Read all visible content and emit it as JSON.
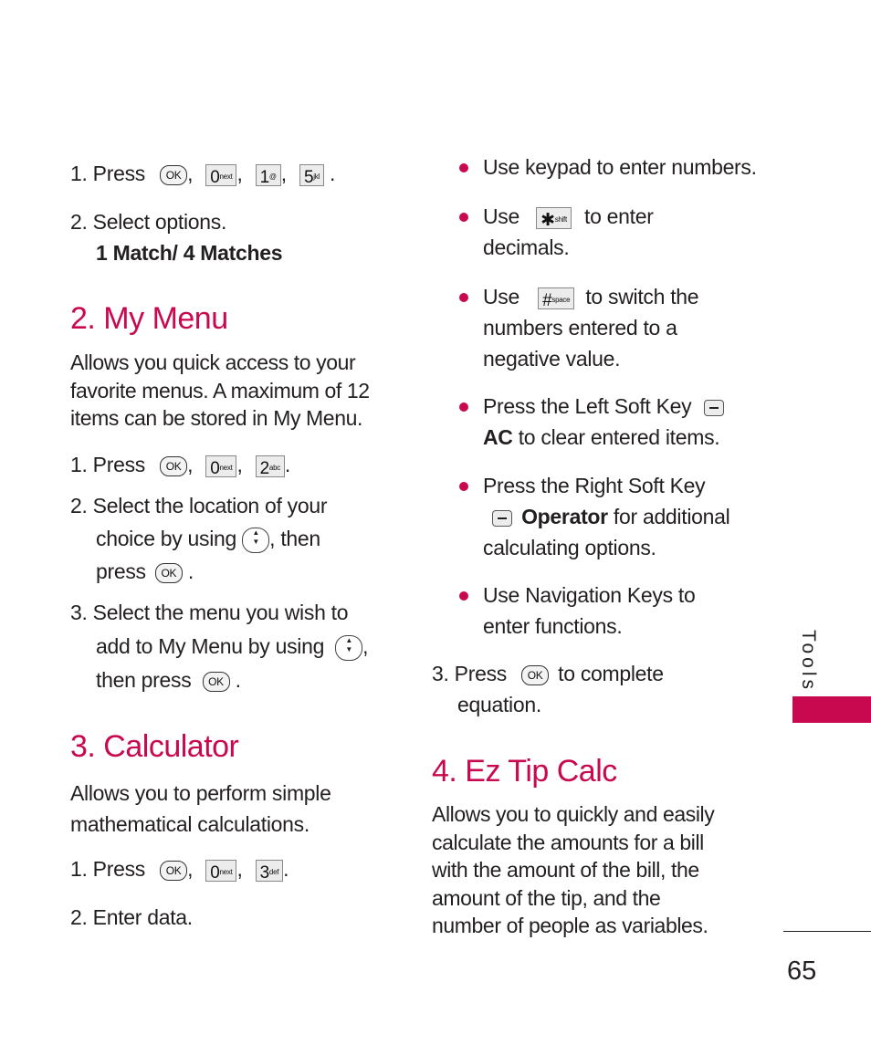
{
  "page": {
    "side_tab": "Tools",
    "page_number": "65",
    "accent_color": "#c8094f"
  },
  "left_column": {
    "intro_step1": {
      "prefix": "1. Press",
      "keys": [
        "OK",
        "0 next",
        "1 @",
        "5 jkl"
      ]
    },
    "intro_step2": {
      "text": "2. Select options.",
      "options": "1 Match/ 4 Matches"
    },
    "my_menu": {
      "heading": "2. My Menu",
      "description": [
        "Allows you quick access to your",
        "favorite menus. A maximum of 12",
        "items can be stored in My Menu."
      ],
      "step1": {
        "prefix": "1. Press",
        "keys": [
          "OK",
          "0 next",
          "2 abc"
        ]
      },
      "step2": {
        "line1": "2. Select the location of your",
        "line2_a": "choice by using",
        "line2_b": ", then",
        "line3": "press"
      },
      "step3": {
        "line1": "3. Select the menu you wish to",
        "line2": "add to My Menu by using",
        "line3": "then press"
      }
    },
    "calculator": {
      "heading": "3. Calculator",
      "description": [
        "Allows you to perform simple",
        "mathematical calculations."
      ],
      "step1": {
        "prefix": "1. Press",
        "keys": [
          "OK",
          "0 next",
          "3 def"
        ]
      },
      "step2": "2. Enter data."
    }
  },
  "right_column": {
    "bullets": [
      {
        "text": "Use keypad to enter numbers."
      },
      {
        "a": "Use",
        "key": "* shift",
        "b": "to enter",
        "c": "decimals."
      },
      {
        "a": "Use",
        "key": "# space",
        "b": "to switch the",
        "c": "numbers entered to a",
        "d": "negative value."
      },
      {
        "a": "Press the Left Soft Key",
        "bold": "AC",
        "b": "to clear entered items."
      },
      {
        "a": "Press the Right Soft Key",
        "bold": "Operator",
        "b": "for additional",
        "c": "calculating options."
      },
      {
        "a": "Use Navigation Keys to",
        "b": "enter functions."
      }
    ],
    "step3": {
      "a": "3. Press",
      "b": "to complete",
      "c": "equation."
    },
    "ez_tip": {
      "heading": "4. Ez Tip Calc",
      "description": [
        "Allows you to quickly and easily",
        "calculate the amounts for a bill",
        "with the amount of the bill, the",
        "amount of the tip, and the",
        "number of people as variables."
      ]
    }
  },
  "keys": {
    "ok": "OK",
    "zero": {
      "digit": "0",
      "sub": "next"
    },
    "one": {
      "digit": "1",
      "sub": "@"
    },
    "two": {
      "digit": "2",
      "sub": "abc"
    },
    "three": {
      "digit": "3",
      "sub": "def"
    },
    "five": {
      "digit": "5",
      "sub": "jkl"
    },
    "star": {
      "digit": "✱",
      "sub": "shift"
    },
    "hash": {
      "digit": "#",
      "sub": "space"
    },
    "nav": {
      "up": "▲",
      "down": "▼"
    }
  }
}
